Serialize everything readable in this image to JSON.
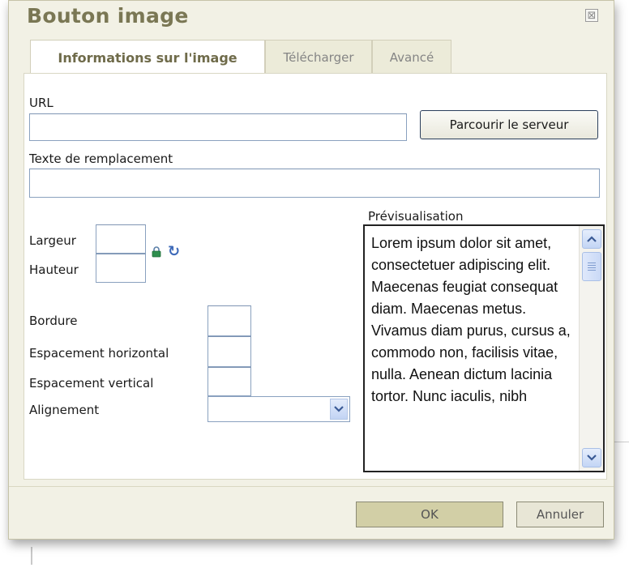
{
  "dialog": {
    "title": "Bouton image",
    "close_symbol": "⊠"
  },
  "tabs": [
    {
      "label": "Informations sur l'image",
      "active": true
    },
    {
      "label": "Télécharger",
      "active": false
    },
    {
      "label": "Avancé",
      "active": false
    }
  ],
  "form": {
    "url_label": "URL",
    "url_value": "",
    "browse_button": "Parcourir le serveur",
    "alt_label": "Texte de remplacement",
    "alt_value": "",
    "width_label": "Largeur",
    "width_value": "",
    "height_label": "Hauteur",
    "height_value": "",
    "border_label": "Bordure",
    "border_value": "",
    "hspace_label": "Espacement horizontal",
    "hspace_value": "",
    "vspace_label": "Espacement vertical",
    "vspace_value": "",
    "align_label": "Alignement",
    "align_value": ""
  },
  "preview": {
    "label": "Prévisualisation",
    "text": "Lorem ipsum dolor sit amet, consectetuer adipiscing elit. Maecenas feugiat consequat diam. Maecenas metus. Vivamus diam purus, cursus a, commodo non, facilisis vitae, nulla. Aenean dictum lacinia tortor. Nunc iaculis, nibh"
  },
  "footer": {
    "ok_label": "OK",
    "cancel_label": "Annuler"
  },
  "icons": {
    "lock": "lock-icon",
    "reset": "reset-size-icon",
    "close": "close-icon"
  }
}
